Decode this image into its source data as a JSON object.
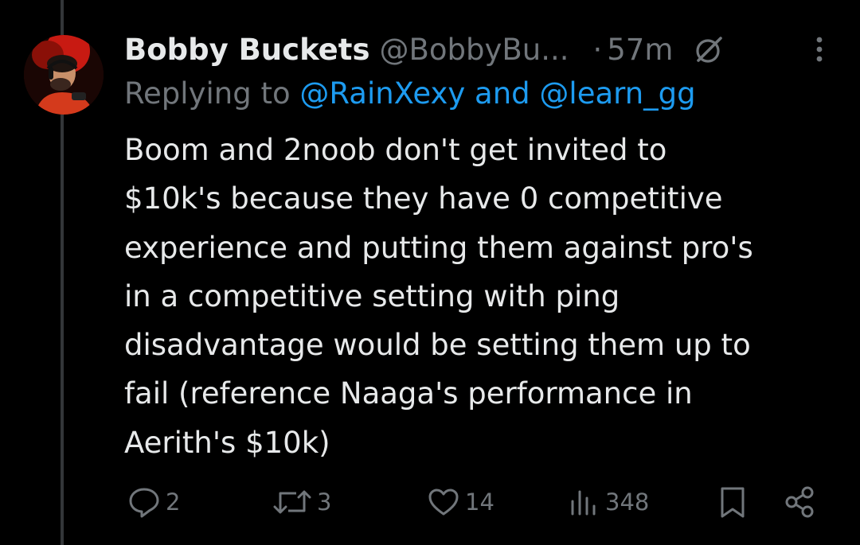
{
  "tweet": {
    "display_name": "Bobby Buckets",
    "handle": "@BobbyBu...",
    "separator": "·",
    "time": "57m",
    "replying_prefix": "Replying to",
    "reply_mention_1": "@RainXexy",
    "reply_join": "and",
    "reply_mention_2": "@learn_gg",
    "body_lines": [
      "Boom and 2noob don't get invited to",
      "$10k's because they have 0 competitive",
      "experience and putting them against pro's",
      "in a competitive setting with ping",
      "disadvantage would be setting them up to",
      "fail (reference Naaga's performance in",
      "Aerith's $10k)"
    ]
  },
  "actions": {
    "replies": "2",
    "reposts": "3",
    "likes": "14",
    "views": "348"
  },
  "icons": [
    "avatar",
    "grok-icon",
    "more-icon",
    "reply-icon",
    "repost-icon",
    "like-icon",
    "views-icon",
    "bookmark-icon",
    "share-icon"
  ],
  "colors": {
    "background": "#000000",
    "text": "#e7e9ea",
    "secondary": "#71767b",
    "link": "#1d9bf0"
  }
}
